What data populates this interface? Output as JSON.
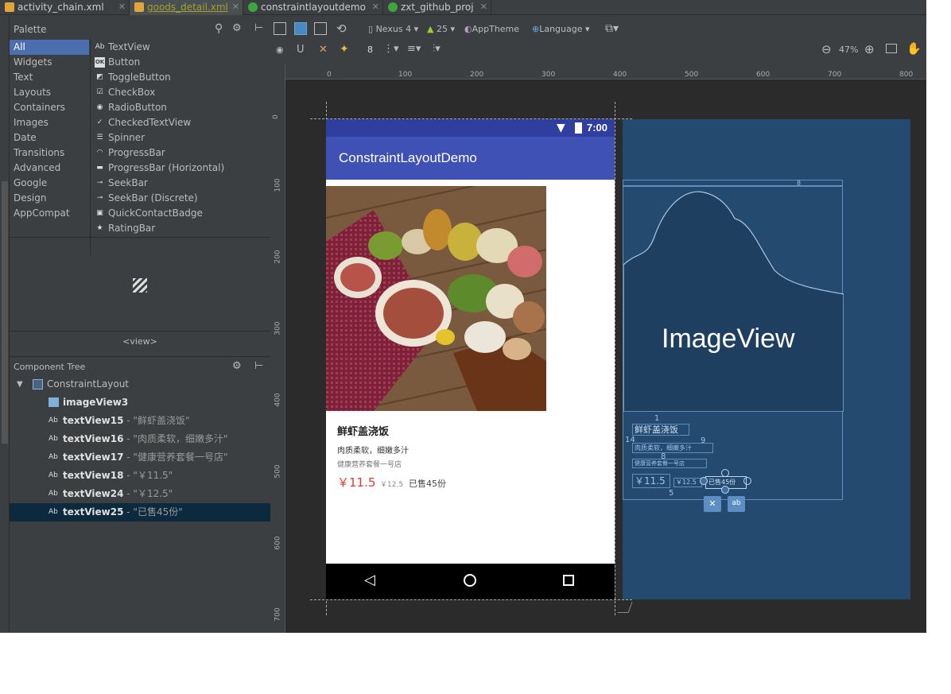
{
  "tabs": [
    {
      "label": "activity_chain.xml",
      "color": "#e3a53a",
      "active": false
    },
    {
      "label": "goods_detail.xml",
      "color": "#e3a53a",
      "active": true
    },
    {
      "label": "constraintlayoutdemo",
      "color": "#3da73d",
      "active": false
    },
    {
      "label": "zxt_github_proj",
      "color": "#3da73d",
      "active": false
    }
  ],
  "palette": {
    "title": "Palette",
    "categories": [
      "All",
      "Widgets",
      "Text",
      "Layouts",
      "Containers",
      "Images",
      "Date",
      "Transitions",
      "Advanced",
      "Google",
      "Design",
      "AppCompat"
    ],
    "selected_category": "All",
    "widgets": [
      {
        "icon": "Ab",
        "label": "TextView"
      },
      {
        "icon": "OK",
        "label": "Button"
      },
      {
        "icon": "◩",
        "label": "ToggleButton"
      },
      {
        "icon": "☑",
        "label": "CheckBox"
      },
      {
        "icon": "◉",
        "label": "RadioButton"
      },
      {
        "icon": "✓",
        "label": "CheckedTextView"
      },
      {
        "icon": "☰",
        "label": "Spinner"
      },
      {
        "icon": "◠",
        "label": "ProgressBar"
      },
      {
        "icon": "▬",
        "label": "ProgressBar (Horizontal)"
      },
      {
        "icon": "⊸",
        "label": "SeekBar"
      },
      {
        "icon": "⊸",
        "label": "SeekBar (Discrete)"
      },
      {
        "icon": "▣",
        "label": "QuickContactBadge"
      },
      {
        "icon": "★",
        "label": "RatingBar"
      }
    ],
    "preview_tag": "<view>"
  },
  "component_tree": {
    "title": "Component Tree",
    "root": "ConstraintLayout",
    "items": [
      {
        "icon": "img",
        "id": "imageView3",
        "text": ""
      },
      {
        "icon": "Ab",
        "id": "textView15",
        "text": " - \"鲜虾盖浇饭\""
      },
      {
        "icon": "Ab",
        "id": "textView16",
        "text": " - \"肉质柔软，细嫩多汁\""
      },
      {
        "icon": "Ab",
        "id": "textView17",
        "text": " - \"健康营养套餐一号店\""
      },
      {
        "icon": "Ab",
        "id": "textView18",
        "text": " - \"￥11.5\""
      },
      {
        "icon": "Ab",
        "id": "textView24",
        "text": " - \"￥12.5\""
      },
      {
        "icon": "Ab",
        "id": "textView25",
        "text": " - \"已售45份\""
      }
    ],
    "selected": "textView25"
  },
  "toolbar": {
    "device": "Nexus 4",
    "api": "25",
    "theme": "AppTheme",
    "language": "Language",
    "margin": "8",
    "zoom": "47%"
  },
  "ruler_h": [
    "0",
    "100",
    "200",
    "300",
    "400",
    "500",
    "600",
    "700",
    "800"
  ],
  "ruler_v": [
    "0",
    "100",
    "200",
    "300",
    "400",
    "500",
    "600",
    "700"
  ],
  "phone": {
    "time": "7:00",
    "app_title": "ConstraintLayoutDemo",
    "name": "鲜虾盖浇饭",
    "desc": "肉质柔软，细嫩多汁",
    "shop": "健康营养套餐一号店",
    "price": "￥11.5",
    "old_price": "￥12.5",
    "sold": "已售45份"
  },
  "blueprint": {
    "imageview_label": "ImageView",
    "bp_name": "鲜虾盖浇饭",
    "bp_desc": "肉质柔软，细嫩多汁",
    "bp_shop": "健康营养套餐一号店",
    "bp_price": "￥11.5",
    "bp_old": "￥12.5",
    "bp_sold": "已售45份",
    "m_top": "8",
    "m_1": "1",
    "m_9": "9",
    "m_14": "14",
    "m_8": "8",
    "m_5": "5"
  },
  "colors": {
    "accent": "#4b6eaf",
    "price_red": "#e53935",
    "app_bar": "#3f51b5",
    "blueprint": "#254a70"
  }
}
